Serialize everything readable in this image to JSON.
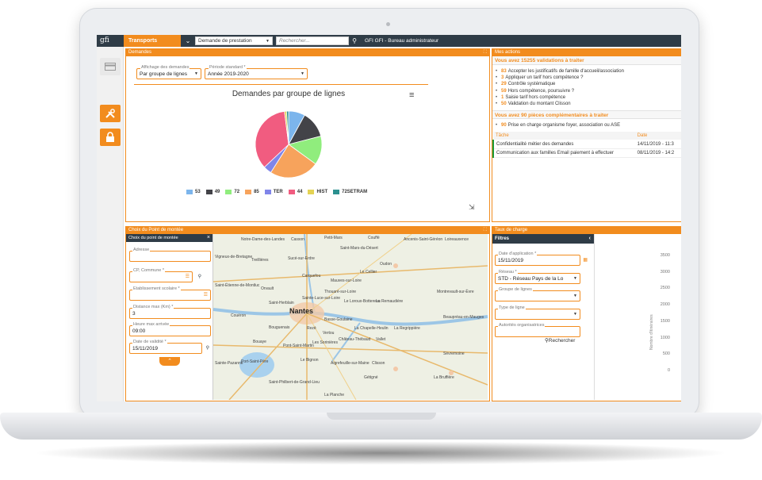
{
  "topbar": {
    "logo": "gfi",
    "module": "Transports Publics",
    "service_select": "Demande de prestation",
    "search_placeholder": "Rechercher...",
    "user": "GFI GFI - Bureau administrateur"
  },
  "demandes": {
    "panel_title": "Demandes",
    "affichage_label": "Affichage des demandes",
    "affichage_value": "Par groupe de lignes",
    "periode_label": "Période standard *",
    "periode_value": "Année 2019-2020",
    "chart_title": "Demandes par groupe de lignes"
  },
  "chart_data": {
    "type": "pie",
    "title": "Demandes par groupe de lignes",
    "categories": [
      "53",
      "49",
      "72",
      "85",
      "TER",
      "44",
      "HIST",
      "72SETRAM"
    ],
    "values": [
      8,
      13,
      14,
      24,
      4,
      35,
      1,
      1
    ],
    "colors": [
      "#7cb5ec",
      "#434348",
      "#90ed7d",
      "#f7a35c",
      "#8085e9",
      "#f15c80",
      "#e4d354",
      "#2b908f"
    ],
    "legend_position": "bottom"
  },
  "actions": {
    "panel_title": "Mes actions",
    "validations_title": "Vous avez 15255 validations à traiter",
    "validations": [
      {
        "count": "83",
        "text": "Accepter les justificatifs de famille d'accueil/association"
      },
      {
        "count": "3",
        "text": "Appliquer un tarif hors compétence ?"
      },
      {
        "count": "29",
        "text": "Contrôle systématique"
      },
      {
        "count": "59",
        "text": "Hors compétence, poursuivre ?"
      },
      {
        "count": "1",
        "text": "Saisie tarif hors compétence"
      },
      {
        "count": "50",
        "text": "Validation du montant Clisson"
      }
    ],
    "pieces_title": "Vous avez 90 pièces complémentaires à traiter",
    "pieces": [
      {
        "count": "90",
        "text": "Prise en charge organisme foyer, association ou ASE"
      }
    ],
    "table_headers": [
      "Tâche",
      "Date"
    ],
    "tasks": [
      {
        "name": "Confidentialité métier des demandes",
        "date": "14/11/2019 - 11:3"
      },
      {
        "name": "Communication aux familles Email paiement à effectuer",
        "date": "08/11/2019 - 14:2"
      }
    ]
  },
  "point_montee": {
    "panel_title": "Choix du Point de montée",
    "form_title": "Choix du point de montée",
    "fields": {
      "adresse": {
        "label": "Adresse",
        "value": ""
      },
      "commune": {
        "label": "CP, Commune *",
        "value": ""
      },
      "etablissement": {
        "label": "Etablissement scolaire *",
        "value": ""
      },
      "distance": {
        "label": "Distance max (Km) *",
        "value": "3"
      },
      "heure": {
        "label": "Heure max arrivée",
        "value": "09:00"
      },
      "date": {
        "label": "Date de validité *",
        "value": "15/11/2019"
      }
    },
    "map_labels": [
      "Notre-Dame-des-Landes",
      "Casson",
      "Petit-Mars",
      "Couffé",
      "Ancenis-Saint-Géréon",
      "Loireauxence",
      "Saint-Mars-du-Désert",
      "Vigneux-de-Bretagne",
      "Treillières",
      "Sucé-sur-Erdre",
      "Oudon",
      "Le Cellier",
      "Saint-Étienne-de-Montluc",
      "Orvault",
      "Carquefou",
      "Mauves-sur-Loire",
      "Thouaré-sur-Loire",
      "Sainte-Luce-sur-Loire",
      "Le Loroux-Bottereau",
      "La Remaudière",
      "Montrevault-sur-Èvre",
      "Saint-Herblain",
      "Nantes",
      "Couëron",
      "Basse-Goulaine",
      "Bouguenais",
      "Rezé",
      "Vertou",
      "La Chapelle-Heulin",
      "La Regrippière",
      "Beaupréau-en-Mauges",
      "Bouaye",
      "Pont-Saint-Martin",
      "Les Sorinières",
      "Château-Thébaud",
      "Vallet",
      "Sèvremoine",
      "Sainte-Pazanne",
      "Port-Saint-Père",
      "Saint-Philbert-de-Grand-Lieu",
      "Le Bignon",
      "Aigrefeuille-sur-Maine",
      "Clisson",
      "Gétigné",
      "La Bruffière",
      "La Planche",
      "Rezé"
    ]
  },
  "taux": {
    "panel_title": "Taux de charge",
    "filters_title": "Filtres",
    "date_label": "Date d'application *",
    "date_value": "15/11/2019",
    "reseau_label": "Réseau *",
    "reseau_value": "STD - Réseau Pays de la Lo",
    "groupe_label": "Groupe de lignes",
    "type_label": "Type de ligne",
    "autorites_label": "Autorités organisatrices",
    "search_button": "Rechercher",
    "y_ticks": [
      "3500",
      "3000",
      "2500",
      "2000",
      "1500",
      "1000",
      "500",
      "0"
    ],
    "y_axis_label": "Nombre d'itinéraires"
  }
}
